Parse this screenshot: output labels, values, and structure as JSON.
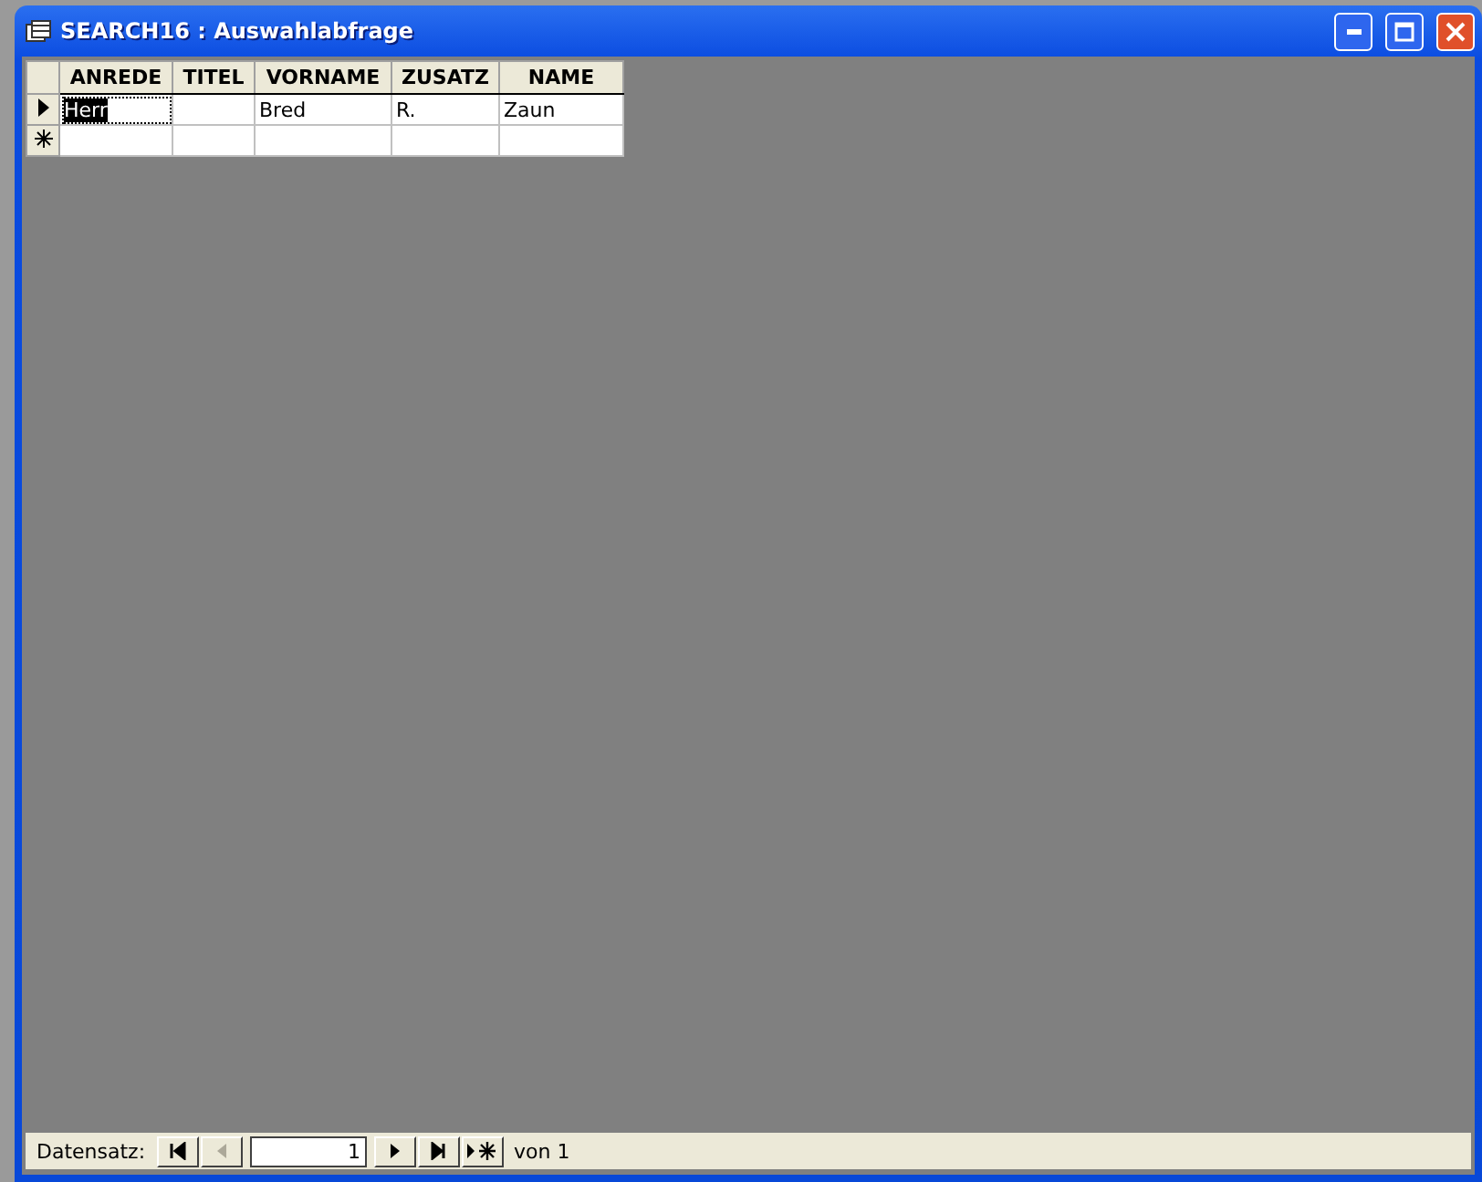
{
  "window": {
    "title": "SEARCH16 : Auswahlabfrage"
  },
  "table": {
    "columns": [
      "ANREDE",
      "TITEL",
      "VORNAME",
      "ZUSATZ",
      "NAME"
    ],
    "rows": [
      {
        "current": true,
        "cells": [
          {
            "text": "Herr",
            "selected": true
          },
          {
            "text": "",
            "selected": false
          },
          {
            "text": "Bred",
            "selected": false
          },
          {
            "text": "R.",
            "selected": false
          },
          {
            "text": "Zaun",
            "selected": false
          }
        ]
      }
    ],
    "new_row": true
  },
  "navigation": {
    "label": "Datensatz:",
    "record": "1",
    "of_label": "von",
    "total": "1",
    "buttons": [
      {
        "kind": "first",
        "disabled": false
      },
      {
        "kind": "prev",
        "disabled": true
      }
    ],
    "buttons_after": [
      {
        "kind": "next",
        "disabled": false
      },
      {
        "kind": "last",
        "disabled": false
      },
      {
        "kind": "new",
        "disabled": false
      }
    ]
  }
}
